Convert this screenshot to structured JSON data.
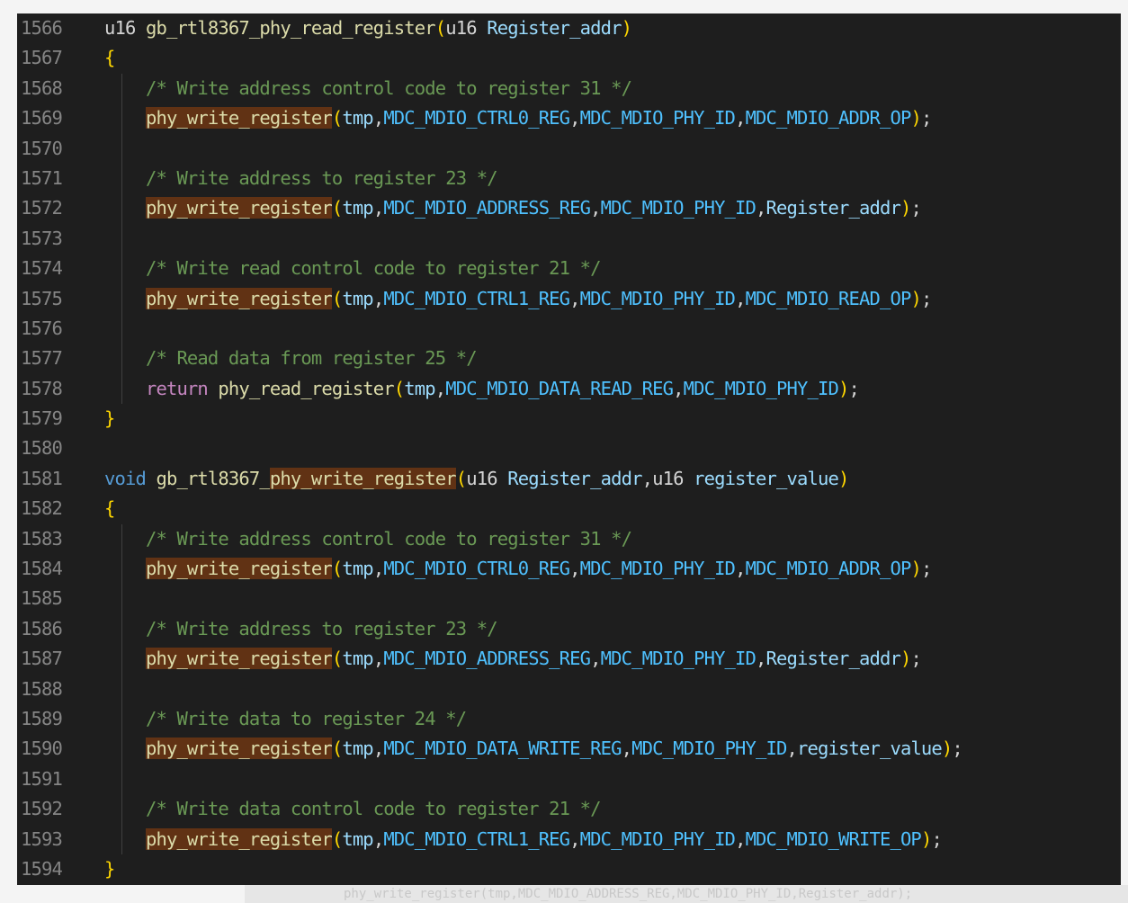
{
  "editor": {
    "lines": [
      {
        "num": "1566",
        "tokens": [
          [
            "u16 ",
            "tok-plain"
          ],
          [
            "gb_rtl8367_phy_read_register",
            "tok-fnw"
          ],
          [
            "(",
            "tok-br"
          ],
          [
            "u16 ",
            "tok-plain"
          ],
          [
            "Register_addr",
            "tok-var"
          ],
          [
            ")",
            "tok-br"
          ]
        ]
      },
      {
        "num": "1567",
        "tokens": [
          [
            "{",
            "tok-br"
          ]
        ]
      },
      {
        "num": "1568",
        "tokens": [
          [
            "    /* Write address control code to register 31 */",
            "tok-cm"
          ]
        ]
      },
      {
        "num": "1569",
        "tokens": [
          [
            "    ",
            "tok-plain"
          ],
          [
            "phy_write_register",
            "tok-hl"
          ],
          [
            "(",
            "tok-br"
          ],
          [
            "tmp",
            "tok-var"
          ],
          [
            ",",
            "tok-pn"
          ],
          [
            "MDC_MDIO_CTRL0_REG",
            "tok-mac"
          ],
          [
            ",",
            "tok-pn"
          ],
          [
            "MDC_MDIO_PHY_ID",
            "tok-mac"
          ],
          [
            ",",
            "tok-pn"
          ],
          [
            "MDC_MDIO_ADDR_OP",
            "tok-mac"
          ],
          [
            ")",
            "tok-br"
          ],
          [
            ";",
            "tok-pn"
          ]
        ]
      },
      {
        "num": "1570",
        "tokens": []
      },
      {
        "num": "1571",
        "tokens": [
          [
            "    /* Write address to register 23 */",
            "tok-cm"
          ]
        ]
      },
      {
        "num": "1572",
        "tokens": [
          [
            "    ",
            "tok-plain"
          ],
          [
            "phy_write_register",
            "tok-hl"
          ],
          [
            "(",
            "tok-br"
          ],
          [
            "tmp",
            "tok-var"
          ],
          [
            ",",
            "tok-pn"
          ],
          [
            "MDC_MDIO_ADDRESS_REG",
            "tok-mac"
          ],
          [
            ",",
            "tok-pn"
          ],
          [
            "MDC_MDIO_PHY_ID",
            "tok-mac"
          ],
          [
            ",",
            "tok-pn"
          ],
          [
            "Register_addr",
            "tok-var"
          ],
          [
            ")",
            "tok-br"
          ],
          [
            ";",
            "tok-pn"
          ]
        ]
      },
      {
        "num": "1573",
        "tokens": []
      },
      {
        "num": "1574",
        "tokens": [
          [
            "    /* Write read control code to register 21 */",
            "tok-cm"
          ]
        ]
      },
      {
        "num": "1575",
        "tokens": [
          [
            "    ",
            "tok-plain"
          ],
          [
            "phy_write_register",
            "tok-hl"
          ],
          [
            "(",
            "tok-br"
          ],
          [
            "tmp",
            "tok-var"
          ],
          [
            ",",
            "tok-pn"
          ],
          [
            "MDC_MDIO_CTRL1_REG",
            "tok-mac"
          ],
          [
            ",",
            "tok-pn"
          ],
          [
            "MDC_MDIO_PHY_ID",
            "tok-mac"
          ],
          [
            ",",
            "tok-pn"
          ],
          [
            "MDC_MDIO_READ_OP",
            "tok-mac"
          ],
          [
            ")",
            "tok-br"
          ],
          [
            ";",
            "tok-pn"
          ]
        ]
      },
      {
        "num": "1576",
        "tokens": []
      },
      {
        "num": "1577",
        "tokens": [
          [
            "    /* Read data from register 25 */",
            "tok-cm"
          ]
        ]
      },
      {
        "num": "1578",
        "tokens": [
          [
            "    ",
            "tok-plain"
          ],
          [
            "return",
            "tok-ret"
          ],
          [
            " ",
            "tok-plain"
          ],
          [
            "phy_read_register",
            "tok-fnw"
          ],
          [
            "(",
            "tok-br"
          ],
          [
            "tmp",
            "tok-var"
          ],
          [
            ",",
            "tok-pn"
          ],
          [
            "MDC_MDIO_DATA_READ_REG",
            "tok-mac"
          ],
          [
            ",",
            "tok-pn"
          ],
          [
            "MDC_MDIO_PHY_ID",
            "tok-mac"
          ],
          [
            ")",
            "tok-br"
          ],
          [
            ";",
            "tok-pn"
          ]
        ]
      },
      {
        "num": "1579",
        "tokens": [
          [
            "}",
            "tok-br"
          ]
        ]
      },
      {
        "num": "1580",
        "tokens": []
      },
      {
        "num": "1581",
        "tokens": [
          [
            "void",
            "tok-type"
          ],
          [
            " ",
            "tok-plain"
          ],
          [
            "gb_rtl8367_",
            "tok-fnw"
          ],
          [
            "phy_write_register",
            "tok-hl"
          ],
          [
            "(",
            "tok-br"
          ],
          [
            "u16 ",
            "tok-plain"
          ],
          [
            "Register_addr",
            "tok-var"
          ],
          [
            ",",
            "tok-pn"
          ],
          [
            "u16 ",
            "tok-plain"
          ],
          [
            "register_value",
            "tok-var"
          ],
          [
            ")",
            "tok-br"
          ]
        ]
      },
      {
        "num": "1582",
        "tokens": [
          [
            "{",
            "tok-br"
          ]
        ]
      },
      {
        "num": "1583",
        "tokens": [
          [
            "    /* Write address control code to register 31 */",
            "tok-cm"
          ]
        ]
      },
      {
        "num": "1584",
        "tokens": [
          [
            "    ",
            "tok-plain"
          ],
          [
            "phy_write_register",
            "tok-hl"
          ],
          [
            "(",
            "tok-br"
          ],
          [
            "tmp",
            "tok-var"
          ],
          [
            ",",
            "tok-pn"
          ],
          [
            "MDC_MDIO_CTRL0_REG",
            "tok-mac"
          ],
          [
            ",",
            "tok-pn"
          ],
          [
            "MDC_MDIO_PHY_ID",
            "tok-mac"
          ],
          [
            ",",
            "tok-pn"
          ],
          [
            "MDC_MDIO_ADDR_OP",
            "tok-mac"
          ],
          [
            ")",
            "tok-br"
          ],
          [
            ";",
            "tok-pn"
          ]
        ]
      },
      {
        "num": "1585",
        "tokens": []
      },
      {
        "num": "1586",
        "tokens": [
          [
            "    /* Write address to register 23 */",
            "tok-cm"
          ]
        ]
      },
      {
        "num": "1587",
        "tokens": [
          [
            "    ",
            "tok-plain"
          ],
          [
            "phy_write_register",
            "tok-hl"
          ],
          [
            "(",
            "tok-br"
          ],
          [
            "tmp",
            "tok-var"
          ],
          [
            ",",
            "tok-pn"
          ],
          [
            "MDC_MDIO_ADDRESS_REG",
            "tok-mac"
          ],
          [
            ",",
            "tok-pn"
          ],
          [
            "MDC_MDIO_PHY_ID",
            "tok-mac"
          ],
          [
            ",",
            "tok-pn"
          ],
          [
            "Register_addr",
            "tok-var"
          ],
          [
            ")",
            "tok-br"
          ],
          [
            ";",
            "tok-pn"
          ]
        ]
      },
      {
        "num": "1588",
        "tokens": []
      },
      {
        "num": "1589",
        "tokens": [
          [
            "    /* Write data to register 24 */",
            "tok-cm"
          ]
        ]
      },
      {
        "num": "1590",
        "tokens": [
          [
            "    ",
            "tok-plain"
          ],
          [
            "phy_write_register",
            "tok-hl"
          ],
          [
            "(",
            "tok-br"
          ],
          [
            "tmp",
            "tok-var"
          ],
          [
            ",",
            "tok-pn"
          ],
          [
            "MDC_MDIO_DATA_WRITE_REG",
            "tok-mac"
          ],
          [
            ",",
            "tok-pn"
          ],
          [
            "MDC_MDIO_PHY_ID",
            "tok-mac"
          ],
          [
            ",",
            "tok-pn"
          ],
          [
            "register_value",
            "tok-var"
          ],
          [
            ")",
            "tok-br"
          ],
          [
            ";",
            "tok-pn"
          ]
        ]
      },
      {
        "num": "1591",
        "tokens": []
      },
      {
        "num": "1592",
        "tokens": [
          [
            "    /* Write data control code to register 21 */",
            "tok-cm"
          ]
        ]
      },
      {
        "num": "1593",
        "tokens": [
          [
            "    ",
            "tok-plain"
          ],
          [
            "phy_write_register",
            "tok-hl"
          ],
          [
            "(",
            "tok-br"
          ],
          [
            "tmp",
            "tok-var"
          ],
          [
            ",",
            "tok-pn"
          ],
          [
            "MDC_MDIO_CTRL1_REG",
            "tok-mac"
          ],
          [
            ",",
            "tok-pn"
          ],
          [
            "MDC_MDIO_PHY_ID",
            "tok-mac"
          ],
          [
            ",",
            "tok-pn"
          ],
          [
            "MDC_MDIO_WRITE_OP",
            "tok-mac"
          ],
          [
            ")",
            "tok-br"
          ],
          [
            ";",
            "tok-pn"
          ]
        ]
      },
      {
        "num": "1594",
        "tokens": [
          [
            "}",
            "tok-br"
          ]
        ]
      }
    ]
  },
  "background": {
    "partial_line": "phy_write_register(tmp,MDC_MDIO_ADDRESS_REG,MDC_MDIO_PHY_ID,Register_addr);"
  },
  "colors": {
    "editor_bg": "#1e1e1e",
    "highlight_bg": "#613214",
    "comment": "#6a9955",
    "macro": "#4fc1ff",
    "variable": "#9cdcfe",
    "function": "#dcdcaa",
    "keyword": "#c586c0",
    "type": "#569cd6",
    "bracket": "#ffd700",
    "line_number": "#858585"
  }
}
